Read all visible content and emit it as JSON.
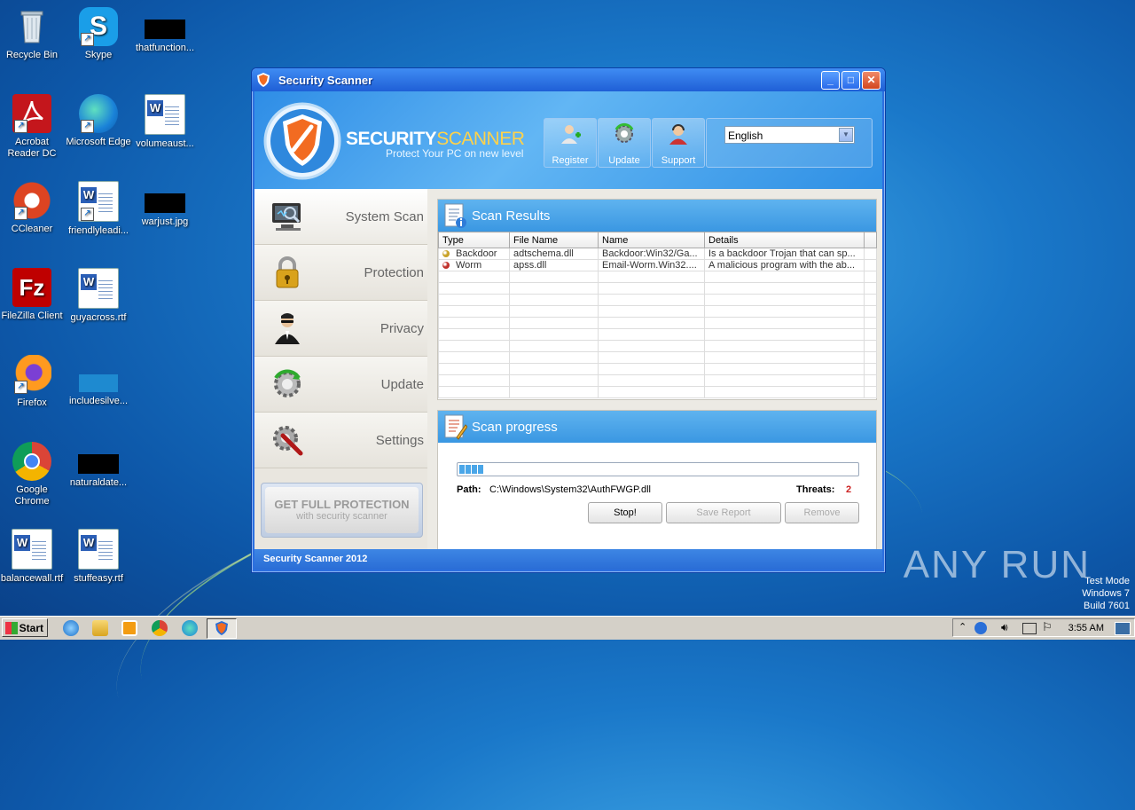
{
  "desktop": {
    "icons": [
      {
        "label": "Recycle Bin"
      },
      {
        "label": "Skype"
      },
      {
        "label": "thatfunction..."
      },
      {
        "label": "Acrobat Reader DC"
      },
      {
        "label": "Microsoft Edge"
      },
      {
        "label": "volumeaust..."
      },
      {
        "label": "CCleaner"
      },
      {
        "label": "friendlyleadi..."
      },
      {
        "label": "warjust.jpg"
      },
      {
        "label": "FileZilla Client"
      },
      {
        "label": "guyacross.rtf"
      },
      {
        "label": "Firefox"
      },
      {
        "label": "includesilve..."
      },
      {
        "label": "Google Chrome"
      },
      {
        "label": "naturaldate..."
      },
      {
        "label": "balancewall.rtf"
      },
      {
        "label": "stuffeasy.rtf"
      }
    ],
    "watermark": "ANY RUN",
    "test_mode": {
      "line1": "Test Mode",
      "line2": "Windows 7",
      "line3": "Build 7601"
    }
  },
  "window": {
    "title": "Security Scanner",
    "brand_part1": "SECURITY",
    "brand_part2": "SCANNER",
    "tagline": "Protect Your PC on new level",
    "header_buttons": [
      {
        "label": "Register",
        "icon": "register-user-icon"
      },
      {
        "label": "Update",
        "icon": "update-gear-icon"
      },
      {
        "label": "Support",
        "icon": "support-agent-icon"
      }
    ],
    "language": {
      "selected": "English"
    },
    "nav": [
      {
        "label": "System Scan",
        "icon": "monitor-scan-icon"
      },
      {
        "label": "Protection",
        "icon": "padlock-icon"
      },
      {
        "label": "Privacy",
        "icon": "spy-agent-icon"
      },
      {
        "label": "Update",
        "icon": "green-refresh-gear-icon"
      },
      {
        "label": "Settings",
        "icon": "settings-gear-wrench-icon"
      }
    ],
    "get_full": {
      "line1": "GET FULL PROTECTION",
      "line2": "with security scanner"
    },
    "scan_results": {
      "title": "Scan Results",
      "columns": [
        "Type",
        "File Name",
        "Name",
        "Details"
      ],
      "rows": [
        {
          "type": "Backdoor",
          "file": "adtschema.dll",
          "name": "Backdoor:Win32/Ga...",
          "details": "Is a backdoor Trojan that can sp...",
          "dot_color": "#c9a227"
        },
        {
          "type": "Worm",
          "file": "apss.dll",
          "name": "Email-Worm.Win32....",
          "details": "A malicious program with the ab...",
          "dot_color": "#c0302a"
        }
      ]
    },
    "scan_progress": {
      "title": "Scan progress",
      "progress_fraction": 0.06,
      "path_label": "Path:",
      "path_value": "C:\\Windows\\System32\\AuthFWGP.dll",
      "threats_label": "Threats:",
      "threats_value": "2",
      "buttons": {
        "stop": "Stop!",
        "save": "Save Report",
        "remove": "Remove"
      }
    },
    "footer": "Security Scanner 2012"
  },
  "taskbar": {
    "start_label": "Start",
    "clock": "3:55 AM"
  },
  "colors": {
    "accent": "#2b6fe0",
    "threat": "#cc2222",
    "brand_yellow": "#ffd24a"
  }
}
